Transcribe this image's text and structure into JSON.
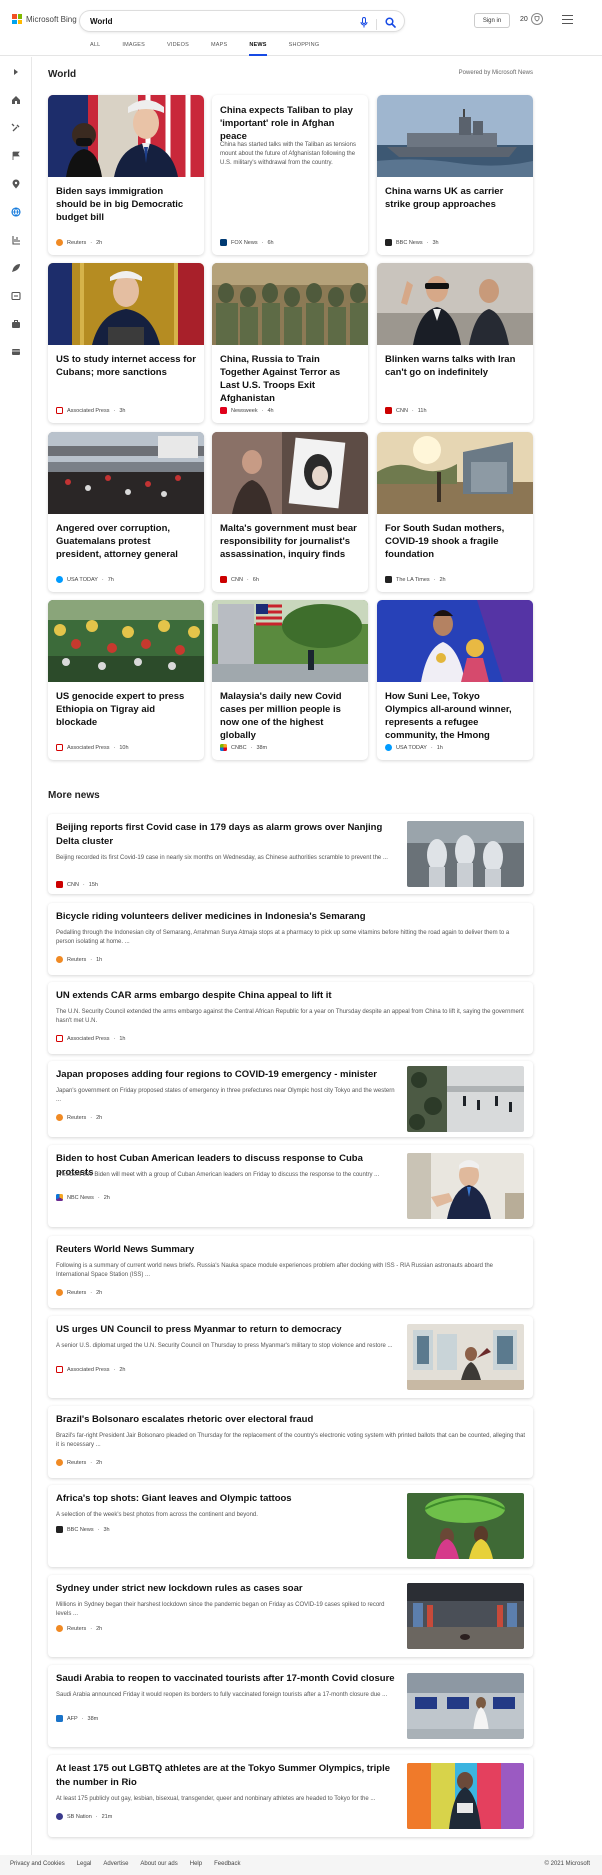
{
  "header": {
    "brand": "Microsoft Bing",
    "query": "World",
    "signin": "Sign in",
    "rewards_count": "20",
    "tabs": [
      "ALL",
      "IMAGES",
      "VIDEOS",
      "MAPS",
      "NEWS",
      "SHOPPING"
    ],
    "active_tab": "NEWS"
  },
  "sidebar": {
    "icons": [
      "expand-icon",
      "home-icon",
      "tools-icon",
      "flag-icon",
      "location-icon",
      "world-icon",
      "science-icon",
      "rocket-icon",
      "sports-icon",
      "business-icon",
      "entertainment-icon"
    ]
  },
  "section": {
    "title": "World",
    "powered": "Powered by Microsoft News",
    "more_title": "More news"
  },
  "cards": [
    {
      "title": "Biden says immigration should be in big Democratic budget bill",
      "source": "Reuters",
      "time": "2h",
      "src_color": "#f08a24"
    },
    {
      "title": "China expects Taliban to play 'important' role in Afghan peace",
      "desc": "China has started talks with the Taliban as tensions mount about the future of Afghanistan following the U.S. military's withdrawal from the country.",
      "source": "FOX News",
      "time": "6h",
      "src_color": "#003a73"
    },
    {
      "title": "China warns UK as carrier strike group approaches",
      "source": "BBC News",
      "time": "3h",
      "src_color": "#222222"
    },
    {
      "title": "US to study internet access for Cubans; more sanctions",
      "source": "Associated Press",
      "time": "3h",
      "src_color": "#d40000"
    },
    {
      "title": "China, Russia to Train Together Against Terror as Last U.S. Troops Exit Afghanistan",
      "source": "Newsweek",
      "time": "4h",
      "src_color": "#e0001b"
    },
    {
      "title": "Blinken warns talks with Iran can't go on indefinitely",
      "source": "CNN",
      "time": "11h",
      "src_color": "#cc0000"
    },
    {
      "title": "Angered over corruption, Guatemalans protest president, attorney general",
      "source": "USA TODAY",
      "time": "7h",
      "src_color": "#009bff"
    },
    {
      "title": "Malta's government must bear responsibility for journalist's assassination, inquiry finds",
      "source": "CNN",
      "time": "6h",
      "src_color": "#cc0000"
    },
    {
      "title": "For South Sudan mothers, COVID-19 shook a fragile foundation",
      "source": "The LA Times",
      "time": "2h",
      "src_color": "#222222"
    },
    {
      "title": "US genocide expert to press Ethiopia on Tigray aid blockade",
      "source": "Associated Press",
      "time": "10h",
      "src_color": "#d40000"
    },
    {
      "title": "Malaysia's daily new Covid cases per million people is now one of the highest globally",
      "source": "CNBC",
      "time": "38m",
      "src_color": "#7a7a7a"
    },
    {
      "title": "How Suni Lee, Tokyo Olympics all-around winner, represents a refugee community, the Hmong",
      "source": "USA TODAY",
      "time": "1h",
      "src_color": "#009bff"
    }
  ],
  "more_news": [
    {
      "title": "Beijing reports first Covid case in 179 days as alarm grows over Nanjing Delta cluster",
      "desc": "Beijing recorded its first Covid-19 case in nearly six months on Wednesday, as Chinese authorities scramble to prevent the ...",
      "source": "CNN",
      "time": "15h",
      "src_color": "#cc0000",
      "has_image": true
    },
    {
      "title": "Bicycle riding volunteers deliver medicines in Indonesia's Semarang",
      "desc": "Pedalling through the Indonesian city of Semarang, Arrahman Surya Atmaja stops at a pharmacy to pick up some vitamins before hitting the road again to deliver them to a person isolating at home. ...",
      "source": "Reuters",
      "time": "1h",
      "src_color": "#f08a24",
      "has_image": false
    },
    {
      "title": "UN extends CAR arms embargo despite China appeal to lift it",
      "desc": "The U.N. Security Council extended the arms embargo against the Central African Republic for a year on Thursday despite an appeal from China to lift it, saying the government hasn't met U.N.",
      "source": "Associated Press",
      "time": "1h",
      "src_color": "#d40000",
      "has_image": false
    },
    {
      "title": "Japan proposes adding four regions to COVID-19 emergency - minister",
      "desc": "Japan's government on Friday proposed states of emergency in three prefectures near Olympic host city Tokyo and the western ...",
      "source": "Reuters",
      "time": "2h",
      "src_color": "#f08a24",
      "has_image": true
    },
    {
      "title": "Biden to host Cuban American leaders to discuss response to Cuba protests",
      "desc": "President Joe Biden will meet with a group of Cuban American leaders on Friday to discuss the response to the country ...",
      "source": "NBC News",
      "time": "2h",
      "src_color": "#6a2c91",
      "has_image": true
    },
    {
      "title": "Reuters World News Summary",
      "desc": "Following is a summary of current world news briefs. Russia's Nauka space module experiences problem after docking with ISS - RIA Russian astronauts aboard the International Space Station (ISS) ...",
      "source": "Reuters",
      "time": "2h",
      "src_color": "#f08a24",
      "has_image": false
    },
    {
      "title": "US urges UN Council to press Myanmar to return to democracy",
      "desc": "A senior U.S. diplomat urged the U.N. Security Council on Thursday to press Myanmar's military to stop violence and restore ...",
      "source": "Associated Press",
      "time": "2h",
      "src_color": "#d40000",
      "has_image": true
    },
    {
      "title": "Brazil's Bolsonaro escalates rhetoric over electoral fraud",
      "desc": "Brazil's far-right President Jair Bolsonaro pleaded on Thursday for the replacement of the country's electronic voting system with printed ballots that can be counted, alleging that it is necessary ...",
      "source": "Reuters",
      "time": "2h",
      "src_color": "#f08a24",
      "has_image": false
    },
    {
      "title": "Africa's top shots: Giant leaves and Olympic tattoos",
      "desc": "A selection of the week's best photos from across the continent and beyond.",
      "source": "BBC News",
      "time": "3h",
      "src_color": "#222222",
      "has_image": true
    },
    {
      "title": "Sydney under strict new lockdown rules as cases soar",
      "desc": "Millions in Sydney began their harshest lockdown since the pandemic began on Friday as COVID-19 cases spiked to record levels ...",
      "source": "Reuters",
      "time": "2h",
      "src_color": "#f08a24",
      "has_image": true
    },
    {
      "title": "Saudi Arabia to reopen to vaccinated tourists after 17-month Covid closure",
      "desc": "Saudi Arabia announced Friday it would reopen its borders to fully vaccinated foreign tourists after a 17-month closure due ...",
      "source": "AFP",
      "time": "38m",
      "src_color": "#1a73c9",
      "has_image": true
    },
    {
      "title": "At least 175 out LGBTQ athletes are at the Tokyo Summer Olympics, triple the number in Rio",
      "desc": "At least 175 publicly out gay, lesbian, bisexual, transgender, queer and nonbinary athletes are headed to Tokyo for the ...",
      "source": "SB Nation",
      "time": "21m",
      "src_color": "#3a3a8c",
      "has_image": true
    }
  ],
  "footer": {
    "links": [
      "Privacy and Cookies",
      "Legal",
      "Advertise",
      "About our ads",
      "Help",
      "Feedback"
    ],
    "copyright": "© 2021 Microsoft"
  }
}
